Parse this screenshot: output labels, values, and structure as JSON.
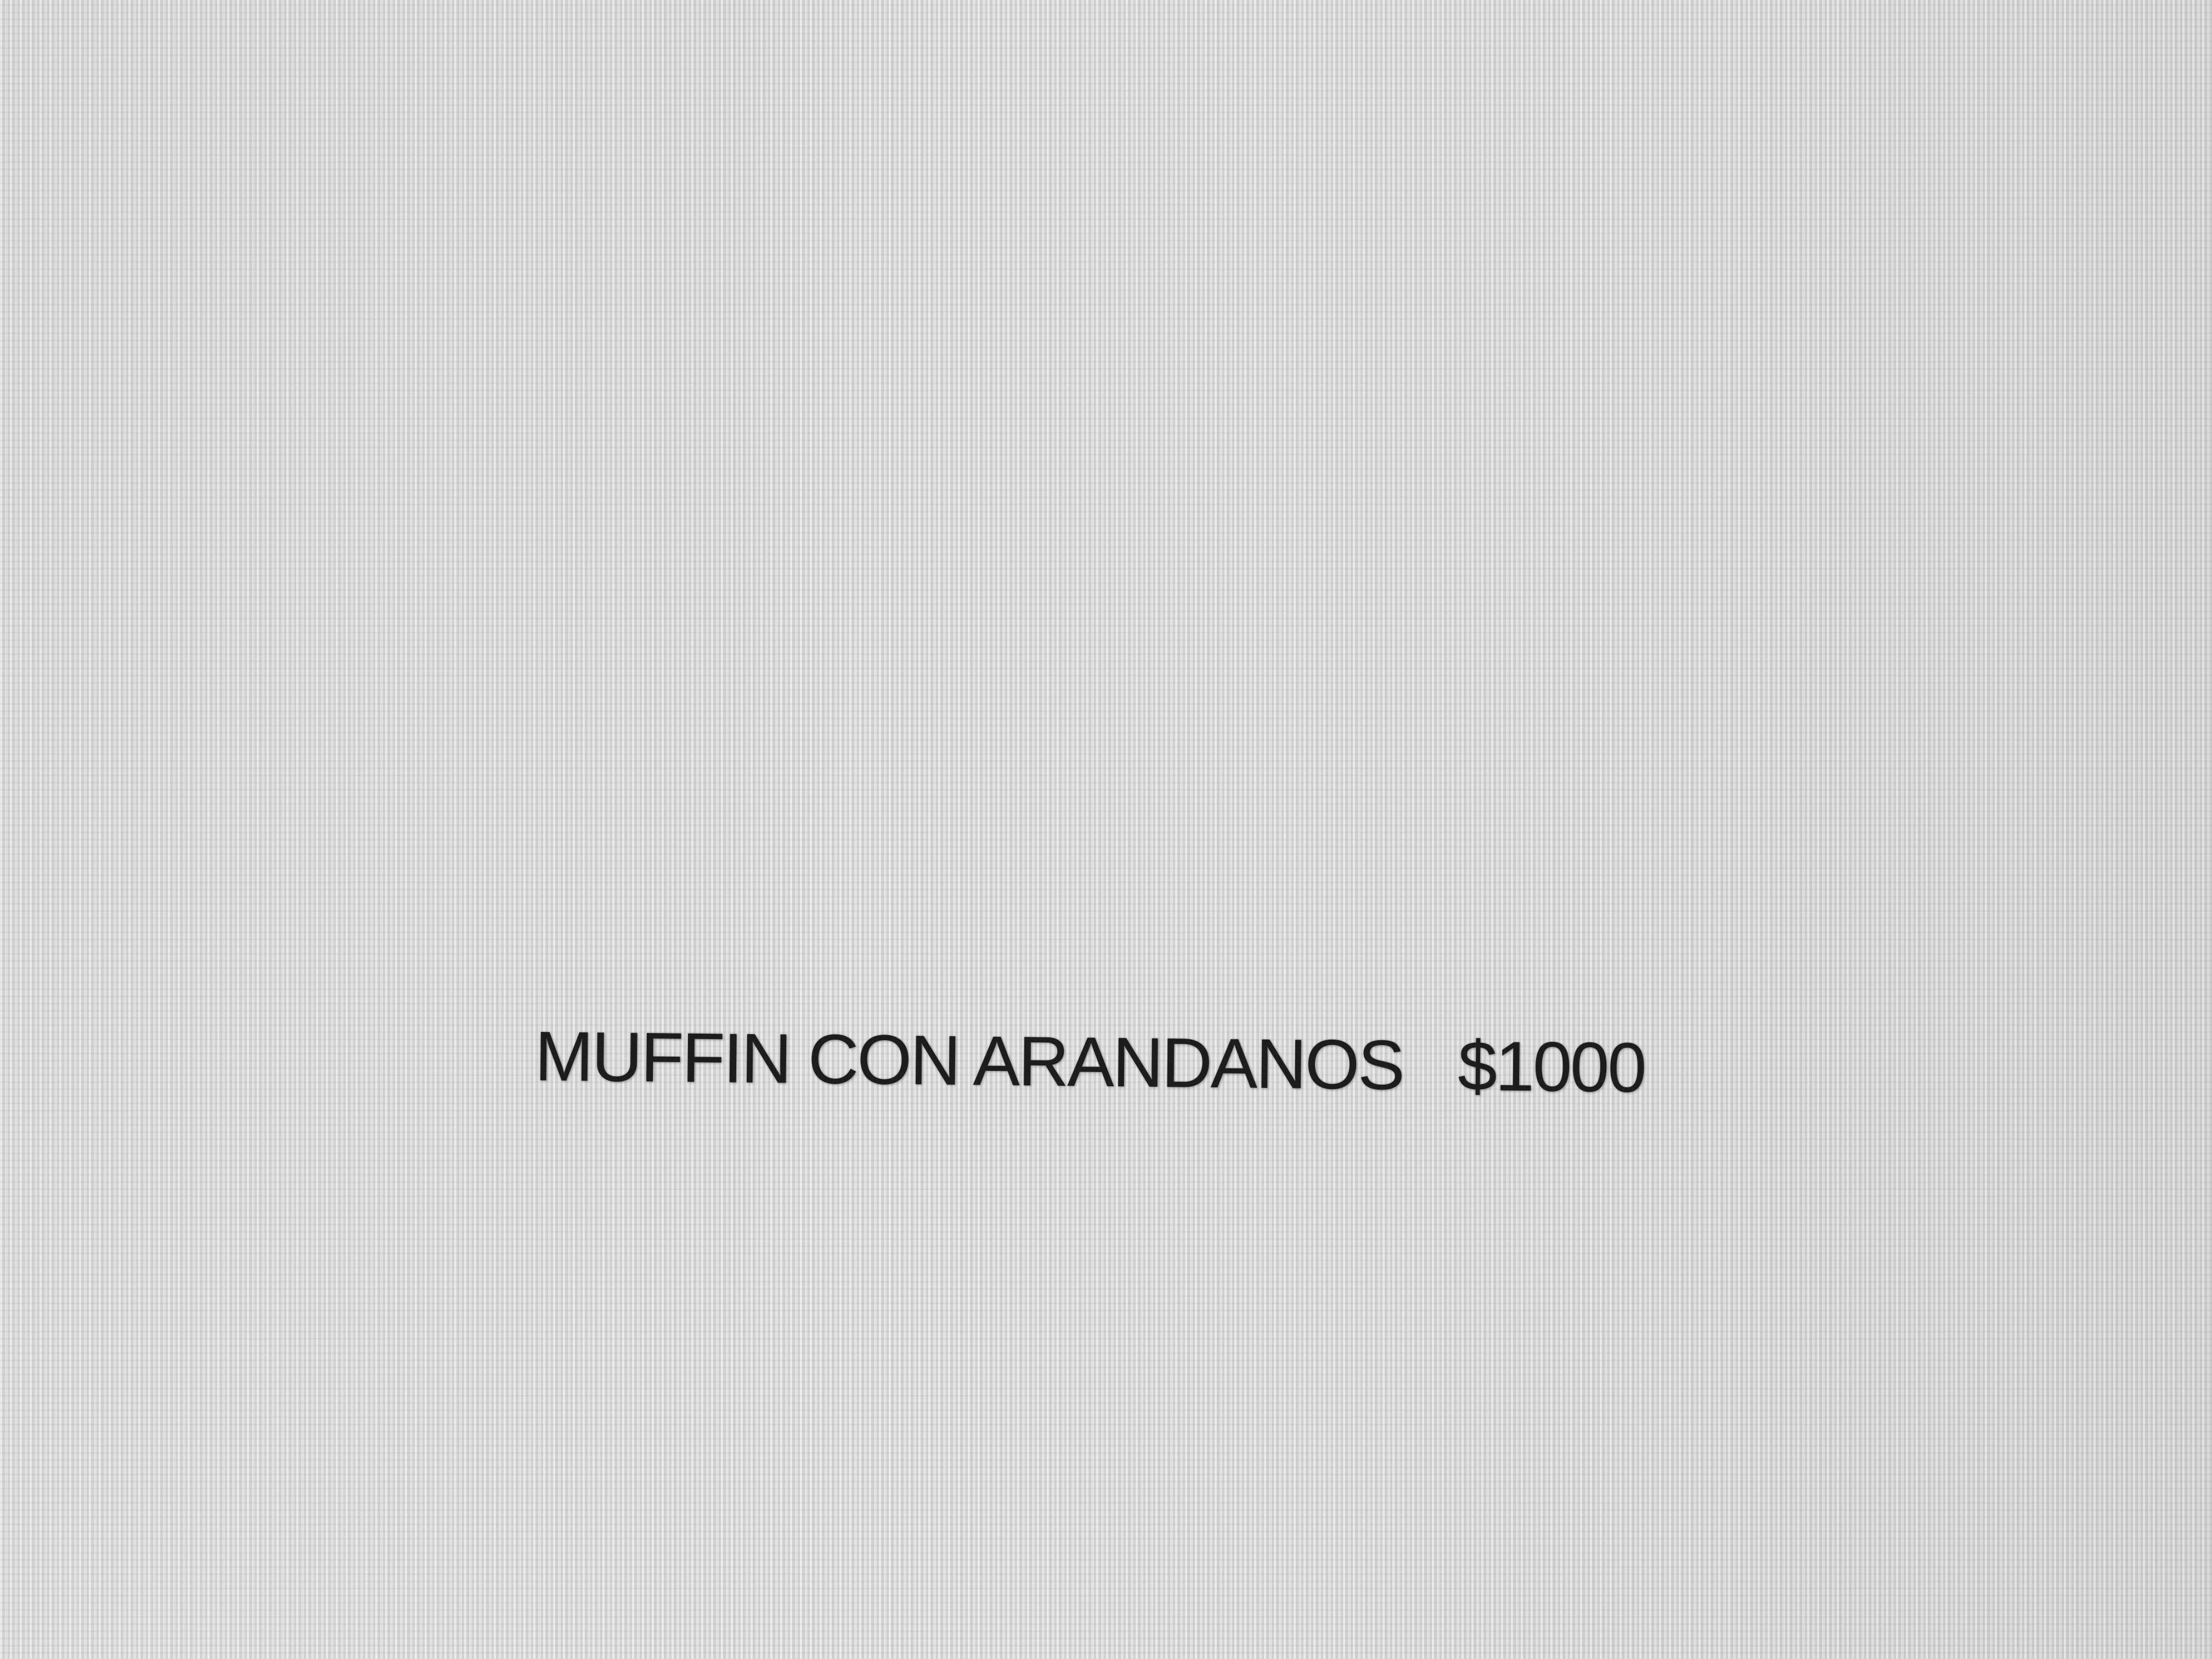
{
  "menu_item": {
    "name": "MUFFIN CON ARANDANOS",
    "price": "$1000"
  }
}
